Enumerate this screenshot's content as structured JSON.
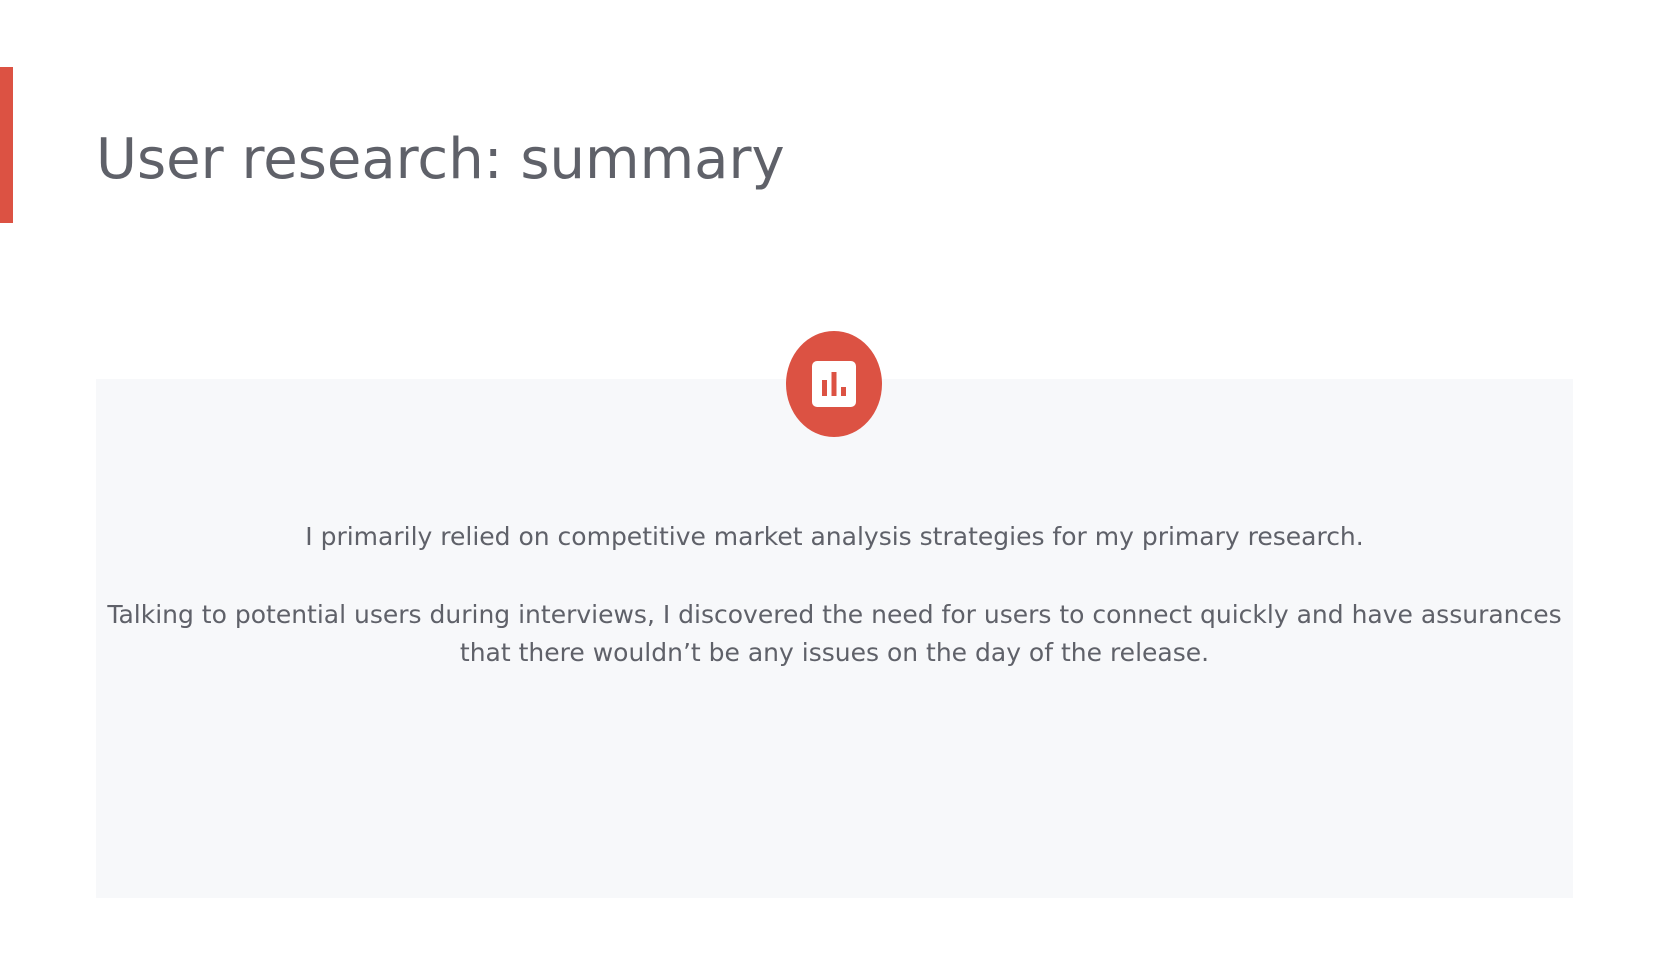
{
  "slide": {
    "title": "User research: summary",
    "accent_color": "#dc5243",
    "icon": "bar-chart-icon",
    "paragraphs": [
      "I primarily relied on competitive market analysis strategies for my primary research.",
      "Talking to potential users during interviews, I discovered the need for users to connect quickly and have assurances that there wouldn’t be any issues on the day of the release."
    ]
  }
}
